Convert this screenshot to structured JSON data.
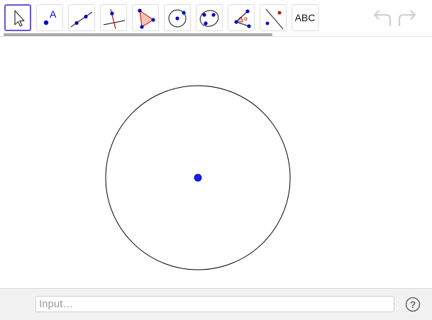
{
  "toolbar": {
    "tools": [
      {
        "name": "move",
        "icon": "arrow-cursor-icon",
        "active": true
      },
      {
        "name": "point",
        "icon": "point-icon",
        "active": false
      },
      {
        "name": "line",
        "icon": "line-icon",
        "active": false
      },
      {
        "name": "perpendicular-line",
        "icon": "perpendicular-icon",
        "active": false
      },
      {
        "name": "polygon",
        "icon": "polygon-icon",
        "active": false
      },
      {
        "name": "circle-center-point",
        "icon": "circle-icon",
        "active": false
      },
      {
        "name": "conic",
        "icon": "conic-icon",
        "active": false
      },
      {
        "name": "angle",
        "icon": "angle-icon",
        "active": false
      },
      {
        "name": "reflect",
        "icon": "reflect-icon",
        "active": false
      },
      {
        "name": "text",
        "icon": "text-icon",
        "active": false
      }
    ],
    "point_tool_letter": "A",
    "angle_tool_letter": "α",
    "text_tool_label": "ABC",
    "undo_icon": "undo-icon",
    "redo_icon": "redo-icon"
  },
  "input_bar": {
    "placeholder": "Input…",
    "help_icon": "help-icon",
    "help_glyph": "?"
  },
  "colors": {
    "accent": "#6557d2",
    "point": "#1a1aff",
    "point_dark": "#0000cc",
    "polygon_fill": "#f7c4b4",
    "red": "#cc0000"
  }
}
